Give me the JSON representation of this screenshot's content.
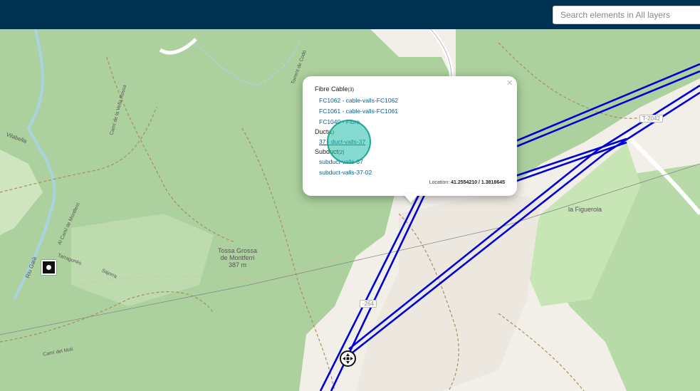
{
  "search": {
    "placeholder": "Search elements in All layers"
  },
  "popup": {
    "close_label": "×",
    "sections": [
      {
        "title": "Fibre Cable",
        "count": "(3)",
        "items": [
          "FC1062 - cable-valls-FC1062",
          "FC1061 - cable-valls-FC1061",
          "FC1040 - Fibre"
        ]
      },
      {
        "title": "Duct",
        "count": "(1)",
        "items": [
          "37 - duct-valls-37"
        ]
      },
      {
        "title": "Subduct",
        "count": "(2)",
        "items": [
          "subduct-valls-37",
          "subduct-valls-37-02"
        ]
      }
    ],
    "location_label": "Location:",
    "location_value": "41.2554210 / 1.3818645"
  },
  "map_labels": {
    "peak_name_1": "Tossa Grossa",
    "peak_name_2": "de Montferri",
    "peak_elevation": "387 m",
    "figuerola": "la Figuerola",
    "road_ref_1": "-264",
    "road_ref_2": "T-2042",
    "vilabella": "Vilabella",
    "cami_vella_rossa": "Camí de la Vella Rossa",
    "torrent": "Torrent de Codó",
    "riu_gaia": "Riu Gaià",
    "cami_montferri": "Al Camí de Montferri",
    "cami_tarragones": "Tarragonès",
    "cami_moli": "Camí del Molí",
    "cami_sajorra": "Sajorra"
  },
  "colors": {
    "topbar": "#003150",
    "cable": "#0000d6",
    "forest": "#add19e",
    "link": "#0a5d8a"
  },
  "icons": {
    "station": "square-dot-icon",
    "node": "junction-node-icon"
  }
}
